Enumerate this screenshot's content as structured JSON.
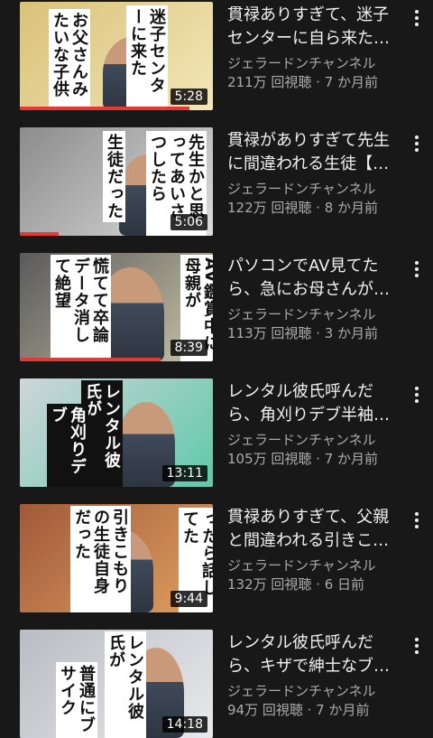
{
  "videos": [
    {
      "title": "貫禄ありすぎて、迷子センターに自ら来た…",
      "channel": "ジェラードンチャンネル",
      "views": "211万 回視聴",
      "age": "7 か月前",
      "duration": "5:28",
      "progress": 0.88,
      "captions": [
        "迷子センターに来た",
        "お父さんみたいな子供"
      ],
      "scene": {
        "bg": "#d9c178",
        "accent": "#f3e7b8"
      },
      "thumbnail_icon": "video-thumbnail"
    },
    {
      "title": "貫禄がありすぎて先生に間違われる生徒【…",
      "channel": "ジェラードンチャンネル",
      "views": "122万 回視聴",
      "age": "8 か月前",
      "duration": "5:06",
      "progress": 0.2,
      "captions": [
        "先生かと思ってあいさつしたら",
        "生徒だった"
      ],
      "scene": {
        "bg": "#8c8c8c",
        "accent": "#dcdcdc"
      },
      "thumbnail_icon": "video-thumbnail"
    },
    {
      "title": "パソコンでAV見てたら、急にお母さんが…",
      "channel": "ジェラードンチャンネル",
      "views": "113万 回視聴",
      "age": "3 か月前",
      "duration": "8:39",
      "progress": 0.73,
      "captions": [
        "AV鑑賞中に母親が",
        "慌てて卒論データ消して絶望"
      ],
      "scene": {
        "bg": "#5a5a5a",
        "accent": "#c9c3a8"
      },
      "thumbnail_icon": "video-thumbnail"
    },
    {
      "title": "レンタル彼氏呼んだら、角刈りデブ半袖…",
      "channel": "ジェラードンチャンネル",
      "views": "105万 回視聴",
      "age": "7 か月前",
      "duration": "13:11",
      "progress": 0,
      "captions": [
        "レンタル彼氏が",
        "角刈りデブ"
      ],
      "scene": {
        "bg": "#cfd6d9",
        "accent": "#5ec9a8"
      },
      "thumbnail_icon": "video-thumbnail"
    },
    {
      "title": "貫禄ありすぎて、父親と間違われる引きこ…",
      "channel": "ジェラードンチャンネル",
      "views": "132万 回視聴",
      "age": "6 日前",
      "duration": "9:44",
      "progress": 0,
      "captions": [
        "引きこもりの生徒自身だった",
        "父親かと思ったら話してた"
      ],
      "scene": {
        "bg": "#a05a3a",
        "accent": "#e0a060"
      },
      "thumbnail_icon": "video-thumbnail"
    },
    {
      "title": "レンタル彼氏呼んだら、キザで紳士なブ…",
      "channel": "ジェラードンチャンネル",
      "views": "94万 回視聴",
      "age": "7 か月前",
      "duration": "14:18",
      "progress": 0,
      "captions": [
        "レンタル彼氏が",
        "普通にブサイク"
      ],
      "scene": {
        "bg": "#b9bcc2",
        "accent": "#e7e9ec"
      },
      "thumbnail_icon": "video-thumbnail"
    }
  ],
  "colors": {
    "background": "#181818",
    "text": "#f1f1f1",
    "secondary": "#aaaaaa",
    "progress": "#e53935"
  },
  "more_icon": "more-vert-icon"
}
